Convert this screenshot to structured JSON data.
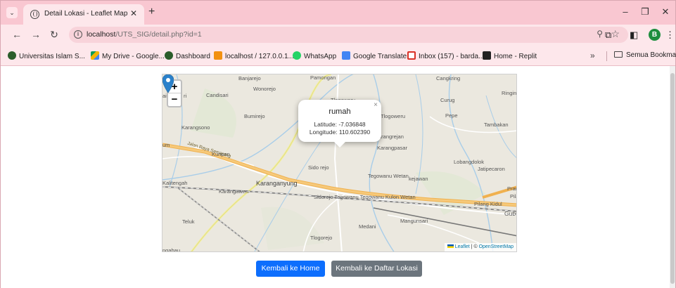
{
  "browser": {
    "tab_title": "Detail Lokasi - Leaflet Map",
    "tab_close_icon": "close-icon",
    "new_tab_symbol": "+",
    "url_host": "localhost",
    "url_path": "/UTS_SIG/detail.php?id=1",
    "profile_initial": "B",
    "window_buttons": {
      "minimize": "–",
      "restore": "❐",
      "close": "✕"
    }
  },
  "bookmarks": {
    "items": [
      {
        "label": "Universitas Islam S...",
        "icon": "graduation-cap-icon",
        "color": "#2b5d2b"
      },
      {
        "label": "My Drive - Google...",
        "icon": "google-drive-icon",
        "color": "#f4b400"
      },
      {
        "label": "Dashboard",
        "icon": "graduation-cap-icon",
        "color": "#2b5d2b"
      },
      {
        "label": "localhost / 127.0.0.1...",
        "icon": "phpmyadmin-icon",
        "color": "#f29111"
      },
      {
        "label": "WhatsApp",
        "icon": "whatsapp-icon",
        "color": "#25d366"
      },
      {
        "label": "Google Translate",
        "icon": "google-translate-icon",
        "color": "#4285f4"
      },
      {
        "label": "Inbox (157) - barda...",
        "icon": "gmail-icon",
        "color": "#d93025"
      },
      {
        "label": "Home - Replit",
        "icon": "replit-icon",
        "color": "#222222"
      }
    ],
    "more": "»",
    "all_bookmarks": "Semua Bookmark"
  },
  "map": {
    "zoom_in": "+",
    "zoom_out": "−",
    "popup": {
      "title": "rumah",
      "latitude_line": "Latitude: -7.036848",
      "longitude_line": "Longitude: 110.602390",
      "close": "×"
    },
    "labels": {
      "banjarejo": "Banjarejo",
      "pamongan": "Pamongan",
      "cangkring": "Cangkring",
      "ringin": "Ringin",
      "wonorejo": "Wonorejo",
      "candisari": "Candisari",
      "tlogoweru": "Tlogoweru",
      "curug": "Curug",
      "bumirejo": "Bumirejo",
      "pepe": "Pepe",
      "tambakan": "Tambakan",
      "karangsono": "Karangsono",
      "karangrejan": "arangrejan",
      "karangpasar": "Karangpasar",
      "kuripan": "Kuripan",
      "sidorejo": "Sido rejo",
      "lobangdolok": "Lobangdolok",
      "jatipecaron": "Jatipecaron",
      "kalitengah": "Kalitengah",
      "karanganyung": "Karanganyung",
      "tegowanu_wetan": "Tegowanu\nWetan",
      "kejawan": "kejawan",
      "karangawen": "Karangawen",
      "tegowanu_kulon": "Sidorejo Tegowanu Tegowanu\n          Kulon      Wetan",
      "pranten": "Prante",
      "pilang_kidul": "Pilang Kidul",
      "gubug": "Gubu",
      "teluk": "Teluk",
      "medani": "Medani",
      "mangunsari": "Mangunsari",
      "tlogorejo": "Tlogorejo",
      "road_name": "Jalan Raya Semarang",
      "um": "um",
      "ai": "ai",
      "ri": "ri",
      "pilar": "Pila",
      "ngabau": "ngabau"
    },
    "attribution": {
      "leaflet": "Leaflet",
      "separator": " | © ",
      "osm": "OpenStreetMap"
    }
  },
  "buttons": {
    "home": "Kembali ke Home",
    "list": "Kembali ke Daftar Lokasi"
  },
  "colors": {
    "chrome_pink": "#f9c7d1",
    "primary": "#0d6efd",
    "secondary": "#6c757d",
    "marker": "#2a81cb"
  }
}
